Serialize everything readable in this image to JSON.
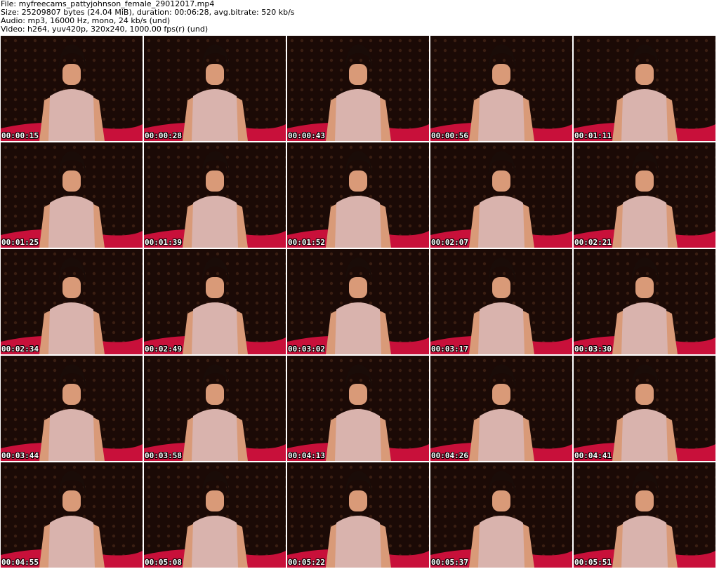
{
  "header": {
    "file_line": "File: myfreecams_pattyjohnson_female_29012017.mp4",
    "size_line": "Size: 25209807 bytes (24.04 MiB), duration: 00:06:28, avg.bitrate: 520 kb/s",
    "audio_line": "Audio: mp3, 16000 Hz, mono, 24 kb/s (und)",
    "video_line": "Video: h264, yuv420p, 320x240, 1000.00 fps(r) (und)"
  },
  "colors": {
    "background": "#1b0a06",
    "top": "#d9b3ad",
    "skin": "#d99a78",
    "hair": "#1a0c08",
    "cloth": "#c8103a",
    "shorts": "#1e2630"
  },
  "thumbnails": [
    {
      "time": "00:00:15"
    },
    {
      "time": "00:00:28"
    },
    {
      "time": "00:00:43"
    },
    {
      "time": "00:00:56"
    },
    {
      "time": "00:01:11"
    },
    {
      "time": "00:01:25"
    },
    {
      "time": "00:01:39"
    },
    {
      "time": "00:01:52"
    },
    {
      "time": "00:02:07"
    },
    {
      "time": "00:02:21"
    },
    {
      "time": "00:02:34"
    },
    {
      "time": "00:02:49"
    },
    {
      "time": "00:03:02"
    },
    {
      "time": "00:03:17"
    },
    {
      "time": "00:03:30"
    },
    {
      "time": "00:03:44"
    },
    {
      "time": "00:03:58"
    },
    {
      "time": "00:04:13"
    },
    {
      "time": "00:04:26"
    },
    {
      "time": "00:04:41"
    },
    {
      "time": "00:04:55"
    },
    {
      "time": "00:05:08"
    },
    {
      "time": "00:05:22"
    },
    {
      "time": "00:05:37"
    },
    {
      "time": "00:05:51"
    }
  ]
}
